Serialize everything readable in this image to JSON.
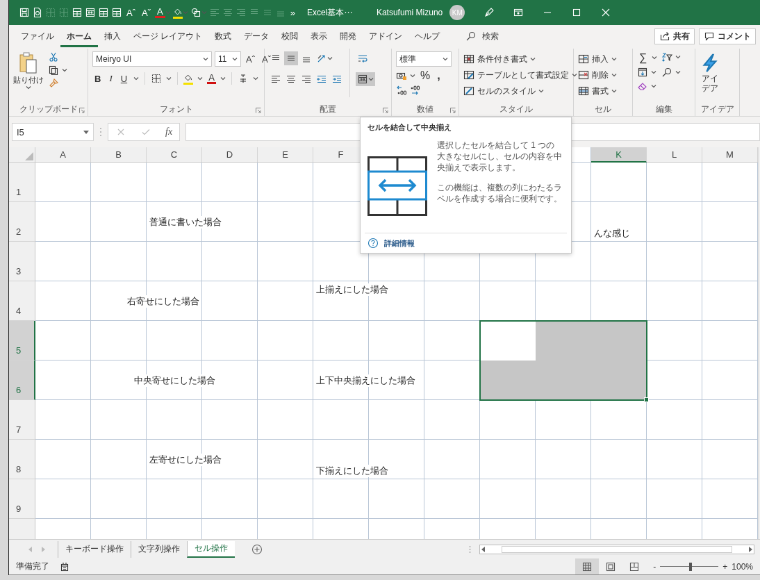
{
  "title_bar": {
    "quick_access": [
      {
        "kind": "save",
        "disabled": false,
        "dropdown": false
      },
      {
        "kind": "preview",
        "disabled": false,
        "dropdown": false
      },
      {
        "kind": "borders",
        "disabled": true,
        "dropdown": false
      },
      {
        "kind": "borders",
        "disabled": true,
        "dropdown": false
      },
      {
        "kind": "table",
        "disabled": false,
        "dropdown": false
      },
      {
        "kind": "merge",
        "disabled": false,
        "dropdown": false
      },
      {
        "kind": "table",
        "disabled": false,
        "dropdown": false
      },
      {
        "kind": "table",
        "disabled": false,
        "dropdown": false
      },
      {
        "kind": "glyph",
        "text": "Aˆ",
        "disabled": false,
        "dropdown": false
      },
      {
        "kind": "glyph",
        "text": "Aˇ",
        "disabled": false,
        "dropdown": false
      },
      {
        "kind": "font-color",
        "text": "A",
        "disabled": false,
        "dropdown": true
      },
      {
        "kind": "fill",
        "disabled": false,
        "dropdown": true
      },
      {
        "kind": "shapes",
        "disabled": false,
        "dropdown": true
      },
      {
        "kind": "align-left",
        "disabled": true,
        "dropdown": false
      },
      {
        "kind": "align-center",
        "disabled": true,
        "dropdown": false
      },
      {
        "kind": "align-right",
        "disabled": true,
        "dropdown": false
      },
      {
        "kind": "align-top",
        "disabled": true,
        "dropdown": false
      },
      {
        "kind": "align-middle",
        "disabled": true,
        "dropdown": false
      },
      {
        "kind": "align-bottom",
        "disabled": true,
        "dropdown": false
      },
      {
        "kind": "glyph",
        "text": "»",
        "disabled": false,
        "dropdown": false
      }
    ],
    "title": "Excel基本⋯",
    "user": "Katsufumi Mizuno",
    "avatar": "KM"
  },
  "menu": {
    "tabs": [
      {
        "label": "ファイル",
        "selected": false
      },
      {
        "label": "ホーム",
        "selected": true
      },
      {
        "label": "挿入",
        "selected": false
      },
      {
        "label": "ページ レイアウト",
        "selected": false
      },
      {
        "label": "数式",
        "selected": false
      },
      {
        "label": "データ",
        "selected": false
      },
      {
        "label": "校閲",
        "selected": false
      },
      {
        "label": "表示",
        "selected": false
      },
      {
        "label": "開発",
        "selected": false
      },
      {
        "label": "アドイン",
        "selected": false
      },
      {
        "label": "ヘルプ",
        "selected": false
      }
    ],
    "search": "検索",
    "share": "共有",
    "comment": "コメント"
  },
  "ribbon": {
    "groups": [
      {
        "kind": "clipboard",
        "label": "クリップボード",
        "launcher": true,
        "paste": "貼り付け"
      },
      {
        "kind": "font",
        "label": "フォント",
        "launcher": true,
        "font_name": "Meiryo UI",
        "font_size": "11",
        "grow": "Aˆ",
        "shrink": "Aˇ",
        "bold": "B",
        "italic": "I",
        "underline": "U",
        "font_color": "A"
      },
      {
        "kind": "alignment",
        "label": "配置",
        "launcher": true,
        "rows": [
          [
            {
              "kind": "align-top",
              "selected": false
            },
            {
              "kind": "align-middle",
              "selected": true
            },
            {
              "kind": "align-bottom",
              "selected": false
            },
            {
              "kind": "orientation",
              "selected": false
            }
          ],
          [
            {
              "kind": "align-left",
              "selected": false
            },
            {
              "kind": "align-center",
              "selected": false
            },
            {
              "kind": "align-right",
              "selected": false
            },
            {
              "kind": "indent-dec",
              "selected": false
            },
            {
              "kind": "indent-inc",
              "selected": false
            }
          ]
        ],
        "side": [
          {
            "kind": "wrap",
            "selected": false
          },
          {
            "kind": "merge",
            "selected": true
          }
        ]
      },
      {
        "kind": "number",
        "label": "数値",
        "launcher": true,
        "format": "標準",
        "percent": "%",
        "comma": ","
      },
      {
        "kind": "styles",
        "label": "スタイル",
        "launcher": false,
        "items": [
          {
            "kind": "conditional",
            "label": "条件付き書式"
          },
          {
            "kind": "table",
            "label": "テーブルとして書式設定"
          },
          {
            "kind": "cell",
            "label": "セルのスタイル"
          }
        ]
      },
      {
        "kind": "cells",
        "label": "セル",
        "launcher": false,
        "items": [
          {
            "kind": "insert",
            "label": "挿入"
          },
          {
            "kind": "delete",
            "label": "削除"
          },
          {
            "kind": "format",
            "label": "書式"
          }
        ]
      },
      {
        "kind": "editing",
        "label": "編集",
        "launcher": false,
        "sum": "∑"
      },
      {
        "kind": "ideas",
        "label": "アイデア",
        "launcher": false,
        "button": "アイデア"
      }
    ]
  },
  "formula_bar": {
    "name_box": "I5",
    "function_glyph": "fx"
  },
  "sheet": {
    "columns": [
      {
        "letter": "A",
        "selected": false
      },
      {
        "letter": "B",
        "selected": false
      },
      {
        "letter": "C",
        "selected": false
      },
      {
        "letter": "D",
        "selected": false
      },
      {
        "letter": "E",
        "selected": false
      },
      {
        "letter": "F",
        "selected": false
      },
      null,
      null,
      null,
      null,
      {
        "letter": "K",
        "selected": true
      },
      {
        "letter": "L",
        "selected": false
      },
      {
        "letter": "M",
        "selected": false
      }
    ],
    "rows": [
      {
        "number": "1",
        "selected": false
      },
      {
        "number": "2",
        "selected": false,
        "cells": [
          null,
          null,
          {
            "text": "普通に書いた場合",
            "kind": "left-middle"
          },
          null,
          null,
          null,
          null,
          null,
          null,
          null,
          {
            "text": "んな感じ",
            "kind": "left-bottom"
          },
          null,
          null
        ]
      },
      {
        "number": "3",
        "selected": false
      },
      {
        "number": "4",
        "selected": false,
        "cells": [
          null,
          null,
          {
            "text": "右寄せにした場合",
            "kind": "right-middle"
          },
          null,
          null,
          {
            "text": "上揃えにした場合",
            "kind": "left-top"
          },
          null,
          null,
          null,
          null,
          null,
          null,
          null
        ]
      },
      {
        "number": "5",
        "selected": true,
        "cells": [
          null,
          null,
          null,
          null,
          null,
          null,
          null,
          null,
          {
            "active": true
          },
          {
            "selected": true
          },
          {
            "selected": true
          },
          null,
          null
        ]
      },
      {
        "number": "6",
        "selected": true,
        "cells": [
          null,
          null,
          {
            "text": "中央寄せにした場合",
            "kind": "center-middle"
          },
          null,
          null,
          {
            "text": "上下中央揃えにした場合",
            "kind": "left-middle"
          },
          null,
          null,
          {
            "selected": true
          },
          {
            "selected": true
          },
          {
            "selected": true
          },
          null,
          null
        ]
      },
      {
        "number": "7",
        "selected": false
      },
      {
        "number": "8",
        "selected": false,
        "cells": [
          null,
          null,
          {
            "text": "左寄せにした場合",
            "kind": "left-middle"
          },
          null,
          null,
          {
            "text": "下揃えにした場合",
            "kind": "left-bottom"
          },
          null,
          null,
          null,
          null,
          null,
          null,
          null
        ]
      },
      {
        "number": "9",
        "selected": false
      }
    ]
  },
  "tooltip": {
    "title": "セルを結合して中央揃え",
    "paragraphs": [
      "選択したセルを結合して 1 つの大きなセルにし、セルの内容を中央揃えで表示します。",
      "この機能は、複数の列にわたるラベルを作成する場合に便利です。"
    ],
    "link": "詳細情報"
  },
  "sheet_tabs": [
    {
      "label": "キーボード操作",
      "selected": false
    },
    {
      "label": "文字列操作",
      "selected": false
    },
    {
      "label": "セル操作",
      "selected": true
    }
  ],
  "status_bar": {
    "text": "準備完了",
    "views": [
      {
        "kind": "normal",
        "selected": true
      },
      {
        "kind": "page-layout",
        "selected": false
      },
      {
        "kind": "page-break",
        "selected": false
      }
    ],
    "zoom": {
      "minus": "-",
      "plus": "+",
      "level": 0.52,
      "reading": "100%"
    }
  }
}
